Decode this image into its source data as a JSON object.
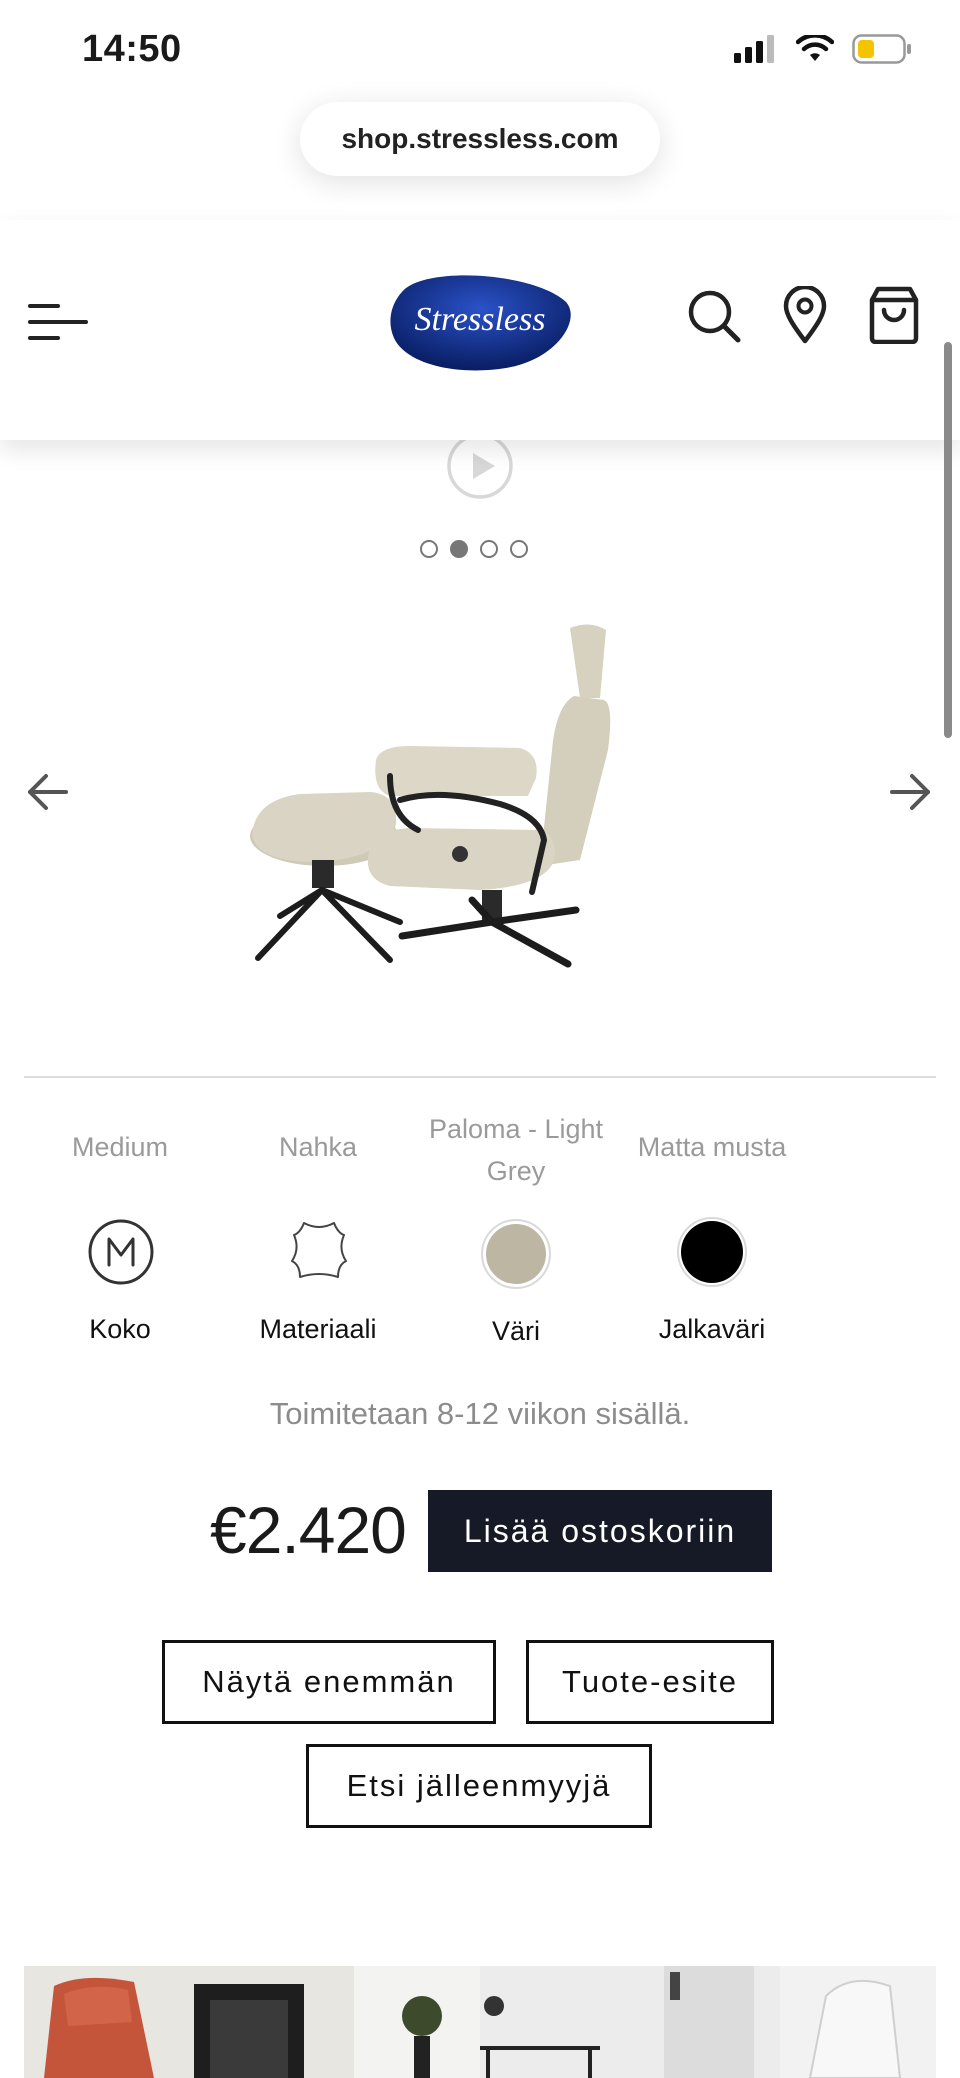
{
  "status_bar": {
    "time": "14:50"
  },
  "browser": {
    "url": "shop.stressless.com"
  },
  "header": {
    "logo_text": "Stressless"
  },
  "carousel": {
    "dot_count": 4,
    "active_dot": 2
  },
  "options": [
    {
      "value": "Medium",
      "label": "Koko",
      "icon": "size-m-icon"
    },
    {
      "value": "Nahka",
      "label": "Materiaali",
      "icon": "leather-icon"
    },
    {
      "value": "Paloma - Light Grey",
      "label": "Väri",
      "icon": "color-swatch-icon",
      "swatch_color": "#bcb6a3"
    },
    {
      "value": "Matta musta",
      "label": "Jalkaväri",
      "icon": "base-color-swatch-icon",
      "swatch_color": "#000000"
    }
  ],
  "delivery_text": "Toimitetaan 8-12 viikon sisällä.",
  "price": "€2.420",
  "buttons": {
    "add_to_cart": "Lisää ostoskoriin",
    "show_more": "Näytä enemmän",
    "brochure": "Tuote-esite",
    "find_dealer": "Etsi jälleenmyyjä"
  },
  "colors": {
    "cart_button_bg": "#151a26",
    "logo_blue": "#0b2a7a"
  }
}
